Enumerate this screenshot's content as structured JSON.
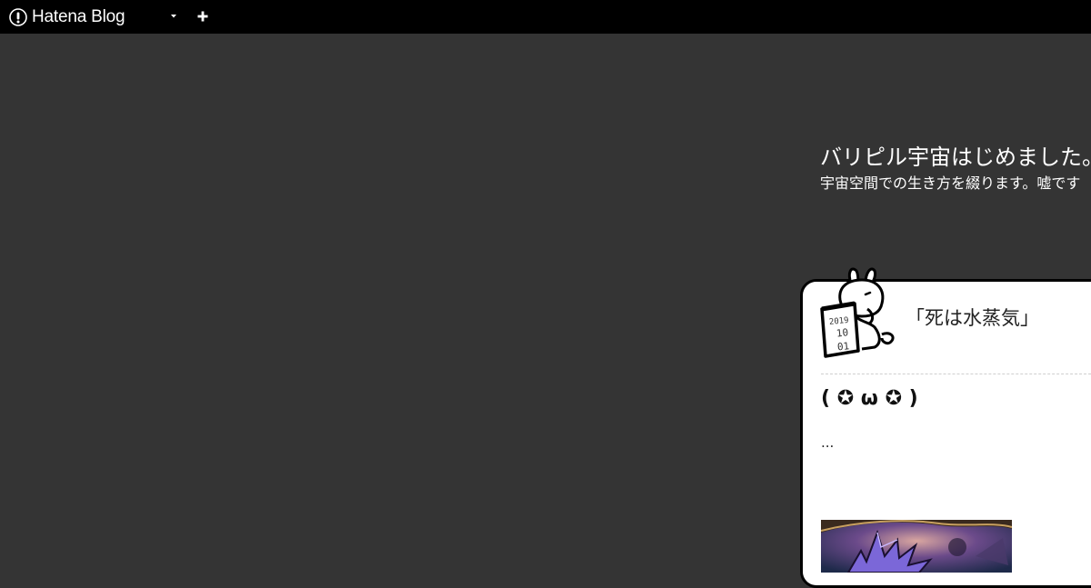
{
  "topbar": {
    "brand": "Hatena Blog",
    "dropdown_icon": "caret-down-icon",
    "add_icon": "plus-icon"
  },
  "blog": {
    "title": "バリピル宇宙はじめました。",
    "description": "宇宙空間での生き方を綴ります。嘘です"
  },
  "entry": {
    "date": {
      "year": "2019",
      "month": "10",
      "day": "01"
    },
    "title": "「死は水蒸気」",
    "heading": "( ✪ ω ✪ )",
    "excerpt": "..."
  },
  "colors": {
    "topbar_bg": "#000000",
    "page_bg": "#343434",
    "card_bg": "#ffffff",
    "text_light": "#ffffff"
  }
}
